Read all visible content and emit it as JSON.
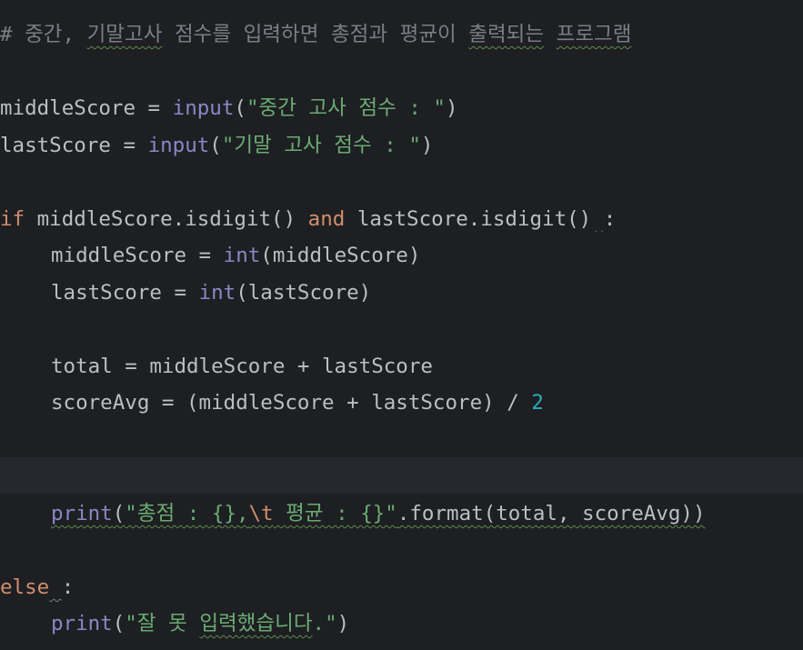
{
  "editor": {
    "comment": {
      "prefix": "# ",
      "w1": "중간,",
      "w2": "기말고사",
      "w3": "점수를",
      "w4": "입력하면",
      "w5": "총점과",
      "w6": "평균이",
      "w7": "출력되는",
      "w8": "프로그램"
    },
    "line_middle": {
      "var": "middleScore",
      "op": " = ",
      "func": "input",
      "open": "(",
      "str": "\"중간 고사 점수 : \"",
      "close": ")"
    },
    "line_last": {
      "var": "lastScore",
      "op": " = ",
      "func": "input",
      "open": "(",
      "str": "\"기말 고사 점수 : \"",
      "close": ")"
    },
    "line_if": {
      "kw_if": "if",
      "cond1": " middleScore.isdigit() ",
      "kw_and": "and",
      "cond2": " lastScore.isdigit()",
      "space": " ",
      "colon": ":"
    },
    "line_int_middle": {
      "lhs": "middleScore = ",
      "func": "int",
      "args": "(middleScore)"
    },
    "line_int_last": {
      "lhs": "lastScore = ",
      "func": "int",
      "args": "(lastScore)"
    },
    "line_total": {
      "text": "total = middleScore + lastScore"
    },
    "line_avg": {
      "text": "scoreAvg = (middleScore + lastScore) / ",
      "num": "2"
    },
    "line_print1": {
      "func": "print",
      "open": "(",
      "str1": "\"총점 : {},",
      "esc": "\\t",
      "str2": " 평균 : {}\"",
      "rest": ".format(total, scoreAvg))"
    },
    "line_else": {
      "kw": "else",
      "space": " ",
      "colon": ":"
    },
    "line_print2": {
      "func": "print",
      "open": "(",
      "str1": "\"잘 못 ",
      "str2": "입력했습니다",
      "str3": ".\"",
      "close": ")"
    }
  }
}
